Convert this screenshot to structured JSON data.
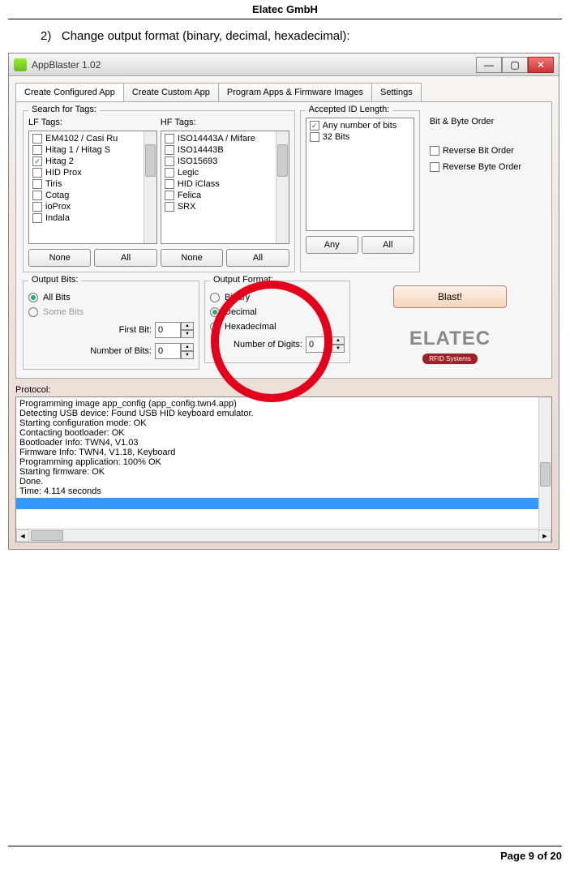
{
  "doc": {
    "header": "Elatec GmbH",
    "step_num": "2)",
    "step_text": "Change output format (binary, decimal, hexadecimal):",
    "footer": "Page 9 of 20"
  },
  "window": {
    "title": "AppBlaster 1.02",
    "min": "—",
    "max": "▢",
    "close": "✕"
  },
  "tabs": {
    "t0": "Create Configured App",
    "t1": "Create Custom App",
    "t2": "Program Apps & Firmware Images",
    "t3": "Settings"
  },
  "search_tags": {
    "title": "Search for Tags:",
    "lf_label": "LF Tags:",
    "hf_label": "HF Tags:",
    "lf": [
      {
        "label": "EM4102 / Casi Ru",
        "checked": false
      },
      {
        "label": "Hitag 1 / Hitag S",
        "checked": false
      },
      {
        "label": "Hitag 2",
        "checked": true
      },
      {
        "label": "HID Prox",
        "checked": false
      },
      {
        "label": "Tiris",
        "checked": false
      },
      {
        "label": "Cotag",
        "checked": false
      },
      {
        "label": "ioProx",
        "checked": false
      },
      {
        "label": "Indala",
        "checked": false
      }
    ],
    "hf": [
      {
        "label": "ISO14443A / Mifare",
        "checked": false
      },
      {
        "label": "ISO14443B",
        "checked": false
      },
      {
        "label": "ISO15693",
        "checked": false
      },
      {
        "label": "Legic",
        "checked": false
      },
      {
        "label": "HID iClass",
        "checked": false
      },
      {
        "label": "Felica",
        "checked": false
      },
      {
        "label": "SRX",
        "checked": false
      }
    ],
    "none": "None",
    "all": "All"
  },
  "accepted": {
    "title": "Accepted ID Length:",
    "items": [
      {
        "label": "Any number of bits",
        "checked": true
      },
      {
        "label": "32 Bits",
        "checked": false
      }
    ],
    "any": "Any",
    "all": "All"
  },
  "bitbyte": {
    "title": "Bit & Byte Order",
    "rev_bit": "Reverse Bit Order",
    "rev_byte": "Reverse Byte Order"
  },
  "output_bits": {
    "title": "Output Bits:",
    "r0": "All Bits",
    "r1": "Some Bits",
    "first_bit_label": "First Bit:",
    "first_bit_val": "0",
    "num_bits_label": "Number of Bits:",
    "num_bits_val": "0"
  },
  "output_format": {
    "title": "Output Format:",
    "r0": "Binary",
    "r1": "Decimal",
    "r2": "Hexadecimal",
    "digits_label": "Number of Digits:",
    "digits_val": "0"
  },
  "blast": "Blast!",
  "logo": {
    "main": "ELATEC",
    "sub": "RFID Systems"
  },
  "protocol": {
    "label": "Protocol:",
    "lines": [
      "Programming image app_config (app_config.twn4.app)",
      "Detecting USB device: Found USB HID keyboard emulator.",
      "Starting configuration mode: OK",
      "Contacting bootloader: OK",
      "Bootloader Info: TWN4, V1.03",
      "Firmware Info: TWN4, V1.18, Keyboard",
      "Programming application: 100% OK",
      "Starting firmware: OK",
      "Done.",
      "Time: 4.114 seconds"
    ]
  }
}
